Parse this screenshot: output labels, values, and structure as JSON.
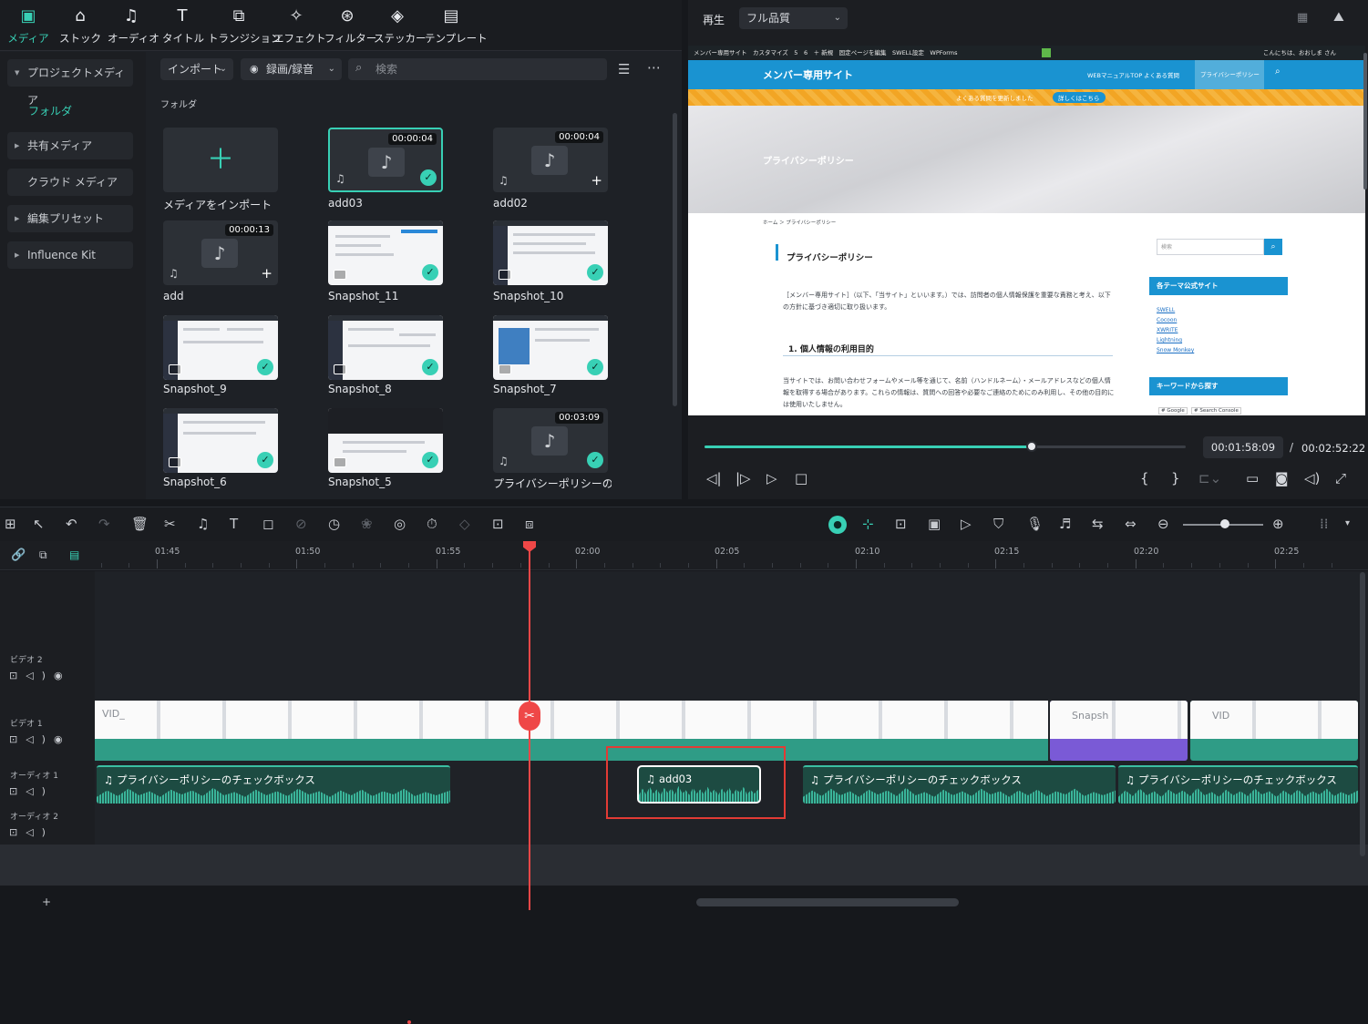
{
  "top_tabs": [
    {
      "label": "メディア",
      "icon": "media-icon"
    },
    {
      "label": "ストック",
      "icon": "stock-icon"
    },
    {
      "label": "オーディオ",
      "icon": "music-note-icon"
    },
    {
      "label": "タイトル",
      "icon": "title-icon"
    },
    {
      "label": "トランジション",
      "icon": "transition-icon"
    },
    {
      "label": "エフェクト",
      "icon": "effect-icon"
    },
    {
      "label": "フィルター",
      "icon": "filter-icon"
    },
    {
      "label": "ステッカー",
      "icon": "sticker-icon"
    },
    {
      "label": "テンプレート",
      "icon": "template-icon"
    }
  ],
  "sidebar": {
    "project_media": "プロジェクトメディア",
    "folder": "フォルダ",
    "shared_media": "共有メディア",
    "cloud_media": "クラウド メディア",
    "edit_presets": "編集プリセット",
    "influence_kit": "Influence Kit"
  },
  "media_toolbar": {
    "import_label": "インポート",
    "record_label": "録画/録音",
    "search_placeholder": "検索"
  },
  "folder_title": "フォルダ",
  "media_items": [
    {
      "label": "メディアをインポート",
      "duration": ""
    },
    {
      "label": "add03",
      "duration": "00:00:04"
    },
    {
      "label": "add02",
      "duration": "00:00:04"
    },
    {
      "label": "add",
      "duration": "00:00:13"
    },
    {
      "label": "Snapshot_11",
      "duration": ""
    },
    {
      "label": "Snapshot_10",
      "duration": ""
    },
    {
      "label": "Snapshot_9",
      "duration": ""
    },
    {
      "label": "Snapshot_8",
      "duration": ""
    },
    {
      "label": "Snapshot_7",
      "duration": ""
    },
    {
      "label": "Snapshot_6",
      "duration": ""
    },
    {
      "label": "Snapshot_5",
      "duration": ""
    },
    {
      "label": "プライバシーポリシーのチェ...",
      "duration": "00:03:09"
    }
  ],
  "preview": {
    "playback_label": "再生",
    "quality": "フル品質",
    "current_time": "00:01:58:09",
    "separator": "/",
    "total_time": "00:02:52:22",
    "progress": 0.68
  },
  "webpage": {
    "adminbar": "メンバー専用サイト　カスタマイズ　5　6　＋ 新規　固定ページを編集　SWELL設定　WPForms",
    "adminbar_right": "こんにちは、おおしま さん",
    "site_title": "メンバー専用サイト",
    "nav": [
      "WEBマニュアルTOP",
      "よくある質問",
      "プライバシーポリシー"
    ],
    "ticker": "よくある質問を更新しました",
    "ticker_button": "詳しくはこちら",
    "hero_title": "プライバシーポリシー",
    "breadcrumb": "ホーム ＞ プライバシーポリシー",
    "page_heading": "プライバシーポリシー",
    "intro": "［メンバー専用サイト］（以下、「当サイト」といいます。）では、訪問者の個人情報保護を重要な責務と考え、以下の方針に基づき適切に取り扱います。",
    "section1": "1. 個人情報の利用目的",
    "body1": "当サイトでは、お問い合わせフォームやメール等を通じて、名前（ハンドルネーム）・メールアドレスなどの個人情報を取得する場合があります。これらの情報は、質問への回答や必要なご連絡のためにのみ利用し、その他の目的には使用いたしません。",
    "side_search": "検索",
    "side_head1": "各テーマ公式サイト",
    "side_links": [
      "SWELL",
      "Cocoon",
      "XWRITE",
      "Lightning",
      "Snow Monkey"
    ],
    "side_head2": "キーワードから探す",
    "keywords": [
      "# Google",
      "# Search Console"
    ]
  },
  "ruler": {
    "labels": [
      "01:45",
      "01:50",
      "01:55",
      "02:00",
      "02:05",
      "02:10",
      "02:15",
      "02:20",
      "02:25"
    ]
  },
  "tracks": {
    "video2": "ビデオ 2",
    "video1": "ビデオ 1",
    "audio1": "オーディオ 1",
    "audio2": "オーディオ 2"
  },
  "clips": {
    "audio_a": "プライバシーポリシーのチェックボックス",
    "audio_b": "add03",
    "audio_c": "プライバシーポリシーのチェックボックス",
    "audio_d": "プライバシーポリシーのチェックボックス",
    "video_a": "VID_",
    "video_b": "Snapsh",
    "video_c": "VID"
  },
  "colors": {
    "accent": "#38d0b5",
    "playhead": "#ef4747",
    "highlight": "#e23b35",
    "purple_clip": "#7a5ad6"
  }
}
